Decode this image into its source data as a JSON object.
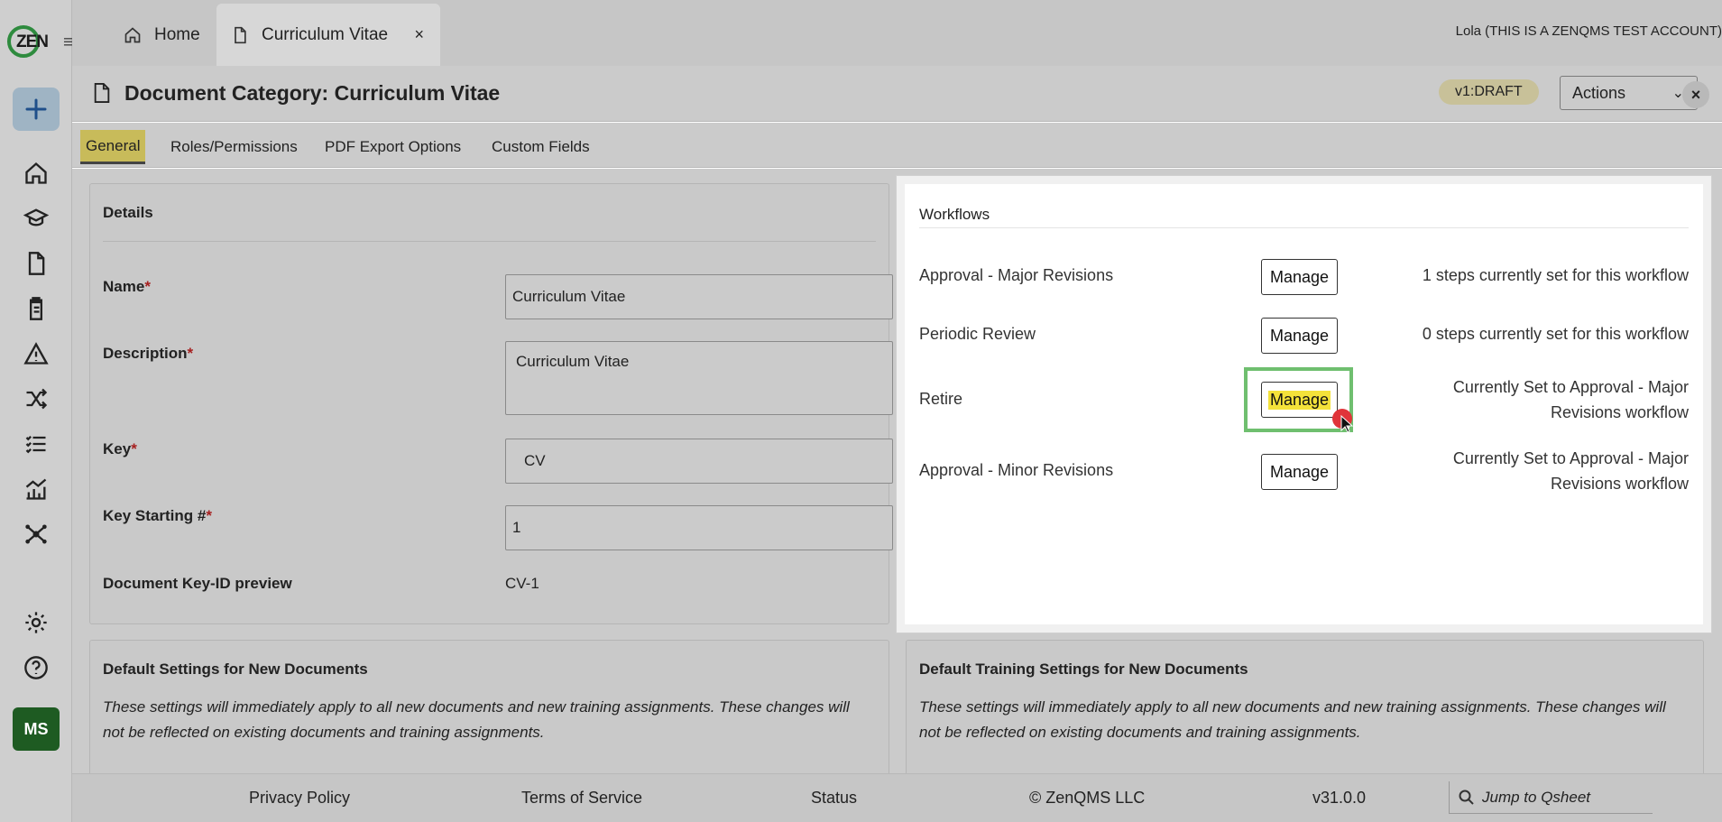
{
  "app": {
    "logo_text": "ZEN",
    "user": "Lola (THIS IS A ZENQMS TEST ACCOUNT)",
    "avatar_initials": "MS"
  },
  "tabs": {
    "home": "Home",
    "current": "Curriculum Vitae",
    "close_glyph": "×"
  },
  "header": {
    "title": "Document Category: Curriculum Vitae",
    "version_badge": "v1:DRAFT",
    "actions_label": "Actions",
    "close_glyph": "×"
  },
  "subtabs": [
    "General",
    "Roles/Permissions",
    "PDF Export Options",
    "Custom Fields"
  ],
  "details": {
    "title": "Details",
    "name_label": "Name",
    "name_value": "Curriculum Vitae",
    "description_label": "Description",
    "description_value": "Curriculum Vitae",
    "key_label": "Key",
    "key_value": "CV",
    "key_start_label": "Key Starting #",
    "key_start_value": "1",
    "preview_label": "Document Key-ID preview",
    "preview_value": "CV-1",
    "required_mark": "*"
  },
  "workflows": {
    "title": "Workflows",
    "manage_label": "Manage",
    "items": [
      {
        "name": "Approval - Major Revisions",
        "desc": "1 steps currently set for this workflow"
      },
      {
        "name": "Periodic Review",
        "desc": "0 steps currently set for this workflow"
      },
      {
        "name": "Retire",
        "desc": "Currently Set to Approval - Major Revisions workflow"
      },
      {
        "name": "Approval - Minor Revisions",
        "desc": "Currently Set to Approval - Major Revisions workflow"
      }
    ]
  },
  "defaults": {
    "title": "Default Settings for New Documents",
    "note": "These settings will immediately apply to all new documents and new training assignments. These changes will not be reflected on existing documents and training assignments."
  },
  "training": {
    "title": "Default Training Settings for New Documents",
    "note": "These settings will immediately apply to all new documents and new training assignments. These changes will not be reflected on existing documents and training assignments."
  },
  "footer": {
    "privacy": "Privacy Policy",
    "terms": "Terms of Service",
    "status": "Status",
    "copyright": "© ZenQMS LLC",
    "version": "v31.0.0",
    "jump_placeholder": "Jump to Qsheet"
  },
  "colors": {
    "accent_green": "#2e8b3e",
    "highlight_yellow": "#f4e23a",
    "focus_green": "#6fbf6f",
    "cursor_red": "#e0343a"
  }
}
